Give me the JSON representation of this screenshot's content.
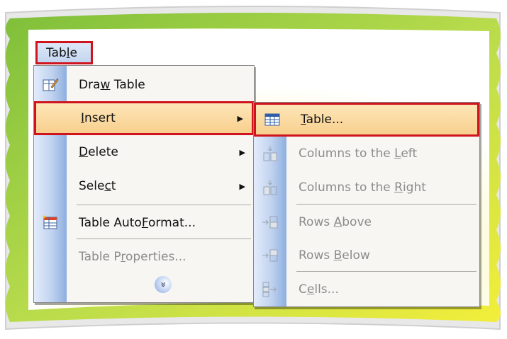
{
  "menubar": {
    "table_label": "Table",
    "table_access_key": "l"
  },
  "main_menu": {
    "items": [
      {
        "label_pre": "Dra",
        "label_key": "w",
        "label_post": " Table",
        "icon": "draw-table-icon"
      },
      {
        "label_pre": "",
        "label_key": "I",
        "label_post": "nsert",
        "submenu": true,
        "highlighted": true
      },
      {
        "label_pre": "",
        "label_key": "D",
        "label_post": "elete",
        "submenu": true
      },
      {
        "label_pre": "Sele",
        "label_key": "c",
        "label_post": "t",
        "submenu": true
      },
      {
        "label_pre": "Table Auto",
        "label_key": "F",
        "label_post": "ormat...",
        "icon": "table-autoformat-icon"
      },
      {
        "label_pre": "Table P",
        "label_key": "r",
        "label_post": "operties...",
        "disabled": true
      }
    ],
    "expand_icon": "double-chevron-down-icon"
  },
  "sub_menu": {
    "items": [
      {
        "label_pre": "",
        "label_key": "T",
        "label_post": "able...",
        "icon": "insert-table-icon",
        "highlighted": true
      },
      {
        "label_pre": "Columns to the ",
        "label_key": "L",
        "label_post": "eft",
        "icon": "insert-columns-left-icon",
        "disabled": true
      },
      {
        "label_pre": "Columns to the ",
        "label_key": "R",
        "label_post": "ight",
        "icon": "insert-columns-right-icon",
        "disabled": true
      },
      {
        "label_pre": "Rows ",
        "label_key": "A",
        "label_post": "bove",
        "icon": "insert-rows-above-icon",
        "disabled": true
      },
      {
        "label_pre": "Rows ",
        "label_key": "B",
        "label_post": "elow",
        "icon": "insert-rows-below-icon",
        "disabled": true
      },
      {
        "label_pre": "C",
        "label_key": "e",
        "label_post": "lls...",
        "icon": "insert-cells-icon",
        "disabled": true
      }
    ]
  },
  "colors": {
    "highlight_border": "#d0141e",
    "highlight_fill": "#f8cf8e",
    "frame_green": "#8cc63f",
    "frame_yellow": "#f3ee3a"
  }
}
